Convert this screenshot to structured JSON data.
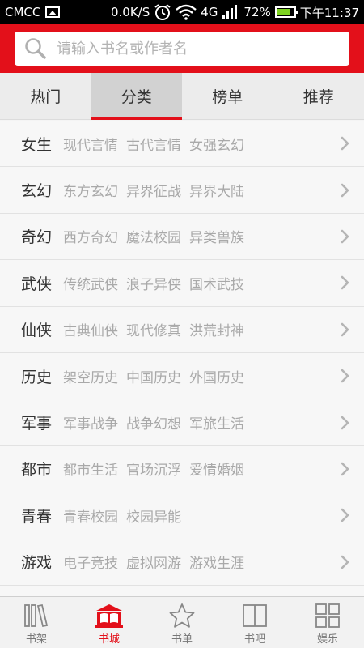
{
  "status": {
    "carrier": "CMCC",
    "speed": "0.0K/S",
    "network": "4G",
    "battery": "72%",
    "time": "下午11:37"
  },
  "search": {
    "placeholder": "请输入书名或作者名"
  },
  "tabs": [
    {
      "label": "热门"
    },
    {
      "label": "分类"
    },
    {
      "label": "榜单"
    },
    {
      "label": "推荐"
    }
  ],
  "categories": [
    {
      "name": "女生",
      "subs": [
        "现代言情",
        "古代言情",
        "女强玄幻"
      ]
    },
    {
      "name": "玄幻",
      "subs": [
        "东方玄幻",
        "异界征战",
        "异界大陆"
      ]
    },
    {
      "name": "奇幻",
      "subs": [
        "西方奇幻",
        "魔法校园",
        "异类兽族"
      ]
    },
    {
      "name": "武侠",
      "subs": [
        "传统武侠",
        "浪子异侠",
        "国术武技"
      ]
    },
    {
      "name": "仙侠",
      "subs": [
        "古典仙侠",
        "现代修真",
        "洪荒封神"
      ]
    },
    {
      "name": "历史",
      "subs": [
        "架空历史",
        "中国历史",
        "外国历史"
      ]
    },
    {
      "name": "军事",
      "subs": [
        "军事战争",
        "战争幻想",
        "军旅生活"
      ]
    },
    {
      "name": "都市",
      "subs": [
        "都市生活",
        "官场沉浮",
        "爱情婚姻"
      ]
    },
    {
      "name": "青春",
      "subs": [
        "青春校园",
        "校园异能"
      ]
    },
    {
      "name": "游戏",
      "subs": [
        "电子竞技",
        "虚拟网游",
        "游戏生涯"
      ]
    }
  ],
  "nav": [
    {
      "label": "书架",
      "icon": "bookshelf-icon"
    },
    {
      "label": "书城",
      "icon": "bookstore-icon"
    },
    {
      "label": "书单",
      "icon": "star-icon"
    },
    {
      "label": "书吧",
      "icon": "open-book-icon"
    },
    {
      "label": "娱乐",
      "icon": "grid-icon"
    }
  ],
  "colors": {
    "brand": "#e3101a",
    "battery": "#7ed321"
  }
}
